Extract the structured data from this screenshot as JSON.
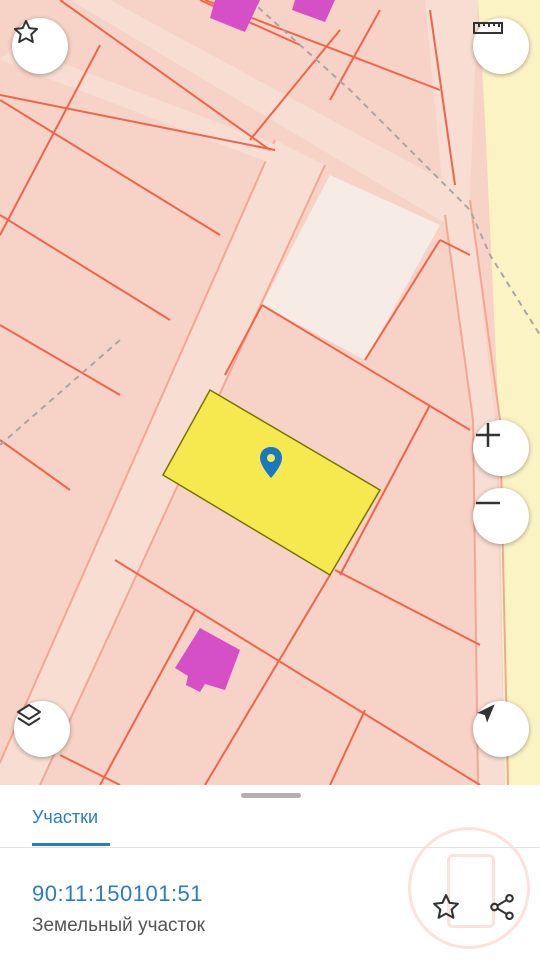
{
  "map": {
    "colors": {
      "background": "#f7d2c6",
      "parcel_border": "#f0654a",
      "road": "#f7ddd2",
      "road_edge": "#f3a793",
      "selected_parcel": "#f5e94f",
      "building": "#d54fc6",
      "neighbor_area": "#fbf3c4",
      "vacant_lot": "#f7ece5",
      "marker": "#1a78c2"
    },
    "marker_icon": "location-pin-icon",
    "controls": {
      "favorite_icon": "star-outline-icon",
      "ruler_icon": "ruler-icon",
      "zoom_in_icon": "plus-icon",
      "zoom_out_icon": "minus-icon",
      "layers_icon": "layers-icon",
      "locate_icon": "navigation-arrow-icon"
    }
  },
  "sheet": {
    "tab_label": "Участки",
    "parcel": {
      "cadastral_number": "90:11:150101:51",
      "type": "Земельный участок"
    },
    "actions": {
      "favorite_icon": "star-outline-icon",
      "share_icon": "share-icon"
    },
    "accent_color": "#2a7cc7"
  }
}
